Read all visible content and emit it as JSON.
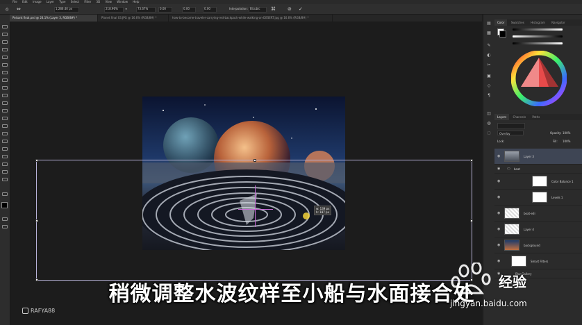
{
  "menubar": [
    "File",
    "Edit",
    "Image",
    "Layer",
    "Type",
    "Select",
    "Filter",
    "3D",
    "View",
    "Window",
    "Help"
  ],
  "options": {
    "x_value": "1,286.40 px",
    "w_value": "218.96%",
    "h_value": "73.67%",
    "angle_value": "0.00",
    "h_skew": "0.00",
    "v_skew": "0.00",
    "interpolation_label": "Interpolation:",
    "interpolation_value": "Bicubic"
  },
  "tabs": [
    {
      "label": "Poisant final.psd @ 24.1% (Layer 3, RGB/8#) *"
    },
    {
      "label": "Planet final 03.JPG @ 16.6% (RGB/8#) *"
    },
    {
      "label": "how-to-become-traveler-carrying-red-backpack-while-walking-on-DESERT.jpg @ 16.6% (RGB/8#) *"
    }
  ],
  "readout": {
    "line1": "w: 139 px",
    "line2": "h: 187 px"
  },
  "subtitle": "稍微调整水波纹样至小船与水面接合处",
  "watermark_text": "RAFYA88",
  "jingyan": {
    "brand": "经验",
    "url": "jingyan.baidu.com"
  },
  "color_panel": {
    "tabs": [
      "Color",
      "Swatches",
      "Histogram",
      "Navigator"
    ]
  },
  "layers_panel": {
    "tabs": [
      "Layers",
      "Channels",
      "Paths"
    ],
    "blend_mode": "Overlay",
    "opacity_label": "Opacity:",
    "opacity_value": "100%",
    "fill_label": "Fill:",
    "fill_value": "100%",
    "lock_label": "Lock:",
    "layers": [
      {
        "name": "Layer 3",
        "selected": true
      },
      {
        "name": "boat",
        "selected": false
      },
      {
        "name": "Color Balance 1",
        "selected": false
      },
      {
        "name": "Levels 1",
        "selected": false
      },
      {
        "name": "boat-edi",
        "selected": false
      },
      {
        "name": "Layer 4",
        "selected": false
      },
      {
        "name": "background",
        "selected": false
      },
      {
        "name": "Smart Filters",
        "selected": false
      },
      {
        "name": "Blur Gallery",
        "selected": false
      }
    ]
  },
  "colors": {
    "accent": "#b7b2d8",
    "selected_layer": "#3e4554",
    "panel_bg": "#2b2b2b"
  }
}
